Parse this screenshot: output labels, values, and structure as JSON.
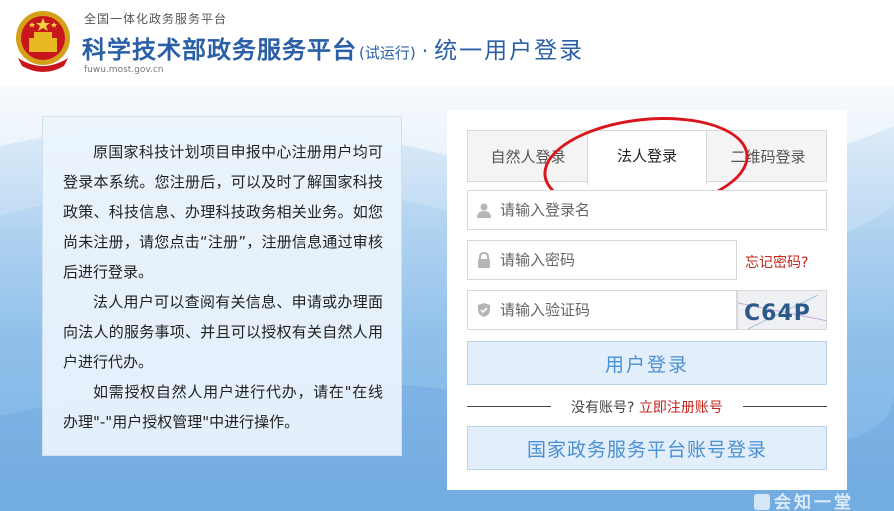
{
  "header": {
    "top_label": "全国一体化政务服务平台",
    "title": "科学技术部政务服务平台",
    "title_sub": "(试运行)",
    "title_separator": "·",
    "title_extra": "统一用户登录",
    "domain": "fuwu.most.gov.cn",
    "emblem_icon": "national-emblem-icon"
  },
  "info": {
    "paragraphs": [
      "原国家科技计划项目申报中心注册用户均可登录本系统。您注册后，可以及时了解国家科技政策、科技信息、办理科技政务相关业务。如您尚未注册，请您点击“注册”，注册信息通过审核后进行登录。",
      "法人用户可以查阅有关信息、申请或办理面向法人的服务事项、并且可以授权有关自然人用户进行代办。",
      "如需授权自然人用户进行代办，请在\"在线办理\"-\"用户授权管理\"中进行操作。"
    ]
  },
  "login": {
    "tabs": [
      {
        "label": "自然人登录",
        "active": false
      },
      {
        "label": "法人登录",
        "active": true
      },
      {
        "label": "二维码登录",
        "active": false
      }
    ],
    "username_placeholder": "请输入登录名",
    "password_placeholder": "请输入密码",
    "forgot_password": "忘记密码?",
    "captcha_placeholder": "请输入验证码",
    "captcha_text": "C64P",
    "login_button": "用户登录",
    "no_account": "没有账号?",
    "register_link": "立即注册账号",
    "gov_login_button": "国家政务服务平台账号登录"
  },
  "watermark": "会知一堂",
  "colors": {
    "title_blue": "#2a5fa8",
    "link_red": "#c6261c",
    "button_bg": "#e2eefa",
    "button_text": "#4a90d4",
    "annotation_red": "#d8161c"
  }
}
